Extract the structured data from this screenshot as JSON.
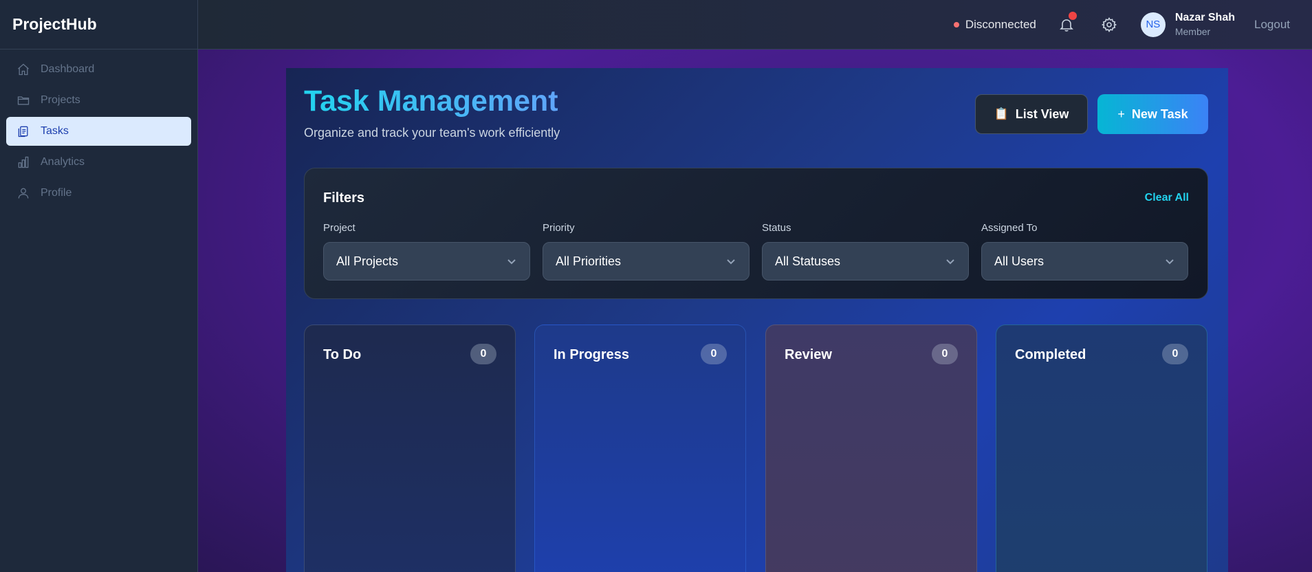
{
  "app": {
    "brand": "ProjectHub"
  },
  "sidebar": {
    "items": [
      {
        "label": "Dashboard",
        "icon": "home-icon",
        "active": false
      },
      {
        "label": "Projects",
        "icon": "folder-icon",
        "active": false
      },
      {
        "label": "Tasks",
        "icon": "clipboard-icon",
        "active": true
      },
      {
        "label": "Analytics",
        "icon": "bar-chart-icon",
        "active": false
      },
      {
        "label": "Profile",
        "icon": "user-icon",
        "active": false
      }
    ]
  },
  "header": {
    "connection_status": "Disconnected",
    "connection_color": "#f87171",
    "notification_badge_color": "#ef4444",
    "user": {
      "initials": "NS",
      "name": "Nazar Shah",
      "role": "Member"
    },
    "logout_label": "Logout"
  },
  "page": {
    "title": "Task Management",
    "subtitle": "Organize and track your team's work efficiently",
    "list_view_label": "List View",
    "list_view_icon": "📋",
    "new_task_label": "New Task",
    "new_task_icon": "+"
  },
  "filters": {
    "title": "Filters",
    "clear_all_label": "Clear All",
    "fields": [
      {
        "label": "Project",
        "value": "All Projects"
      },
      {
        "label": "Priority",
        "value": "All Priorities"
      },
      {
        "label": "Status",
        "value": "All Statuses"
      },
      {
        "label": "Assigned To",
        "value": "All Users"
      }
    ]
  },
  "board": {
    "columns": [
      {
        "title": "To Do",
        "count": "0"
      },
      {
        "title": "In Progress",
        "count": "0"
      },
      {
        "title": "Review",
        "count": "0"
      },
      {
        "title": "Completed",
        "count": "0"
      }
    ]
  },
  "colors": {
    "accent": "#22d3ee",
    "primary_gradient": [
      "#06b6d4",
      "#3b82f6"
    ],
    "active_nav_bg": "#dbeafe",
    "active_nav_text": "#1e40af"
  }
}
